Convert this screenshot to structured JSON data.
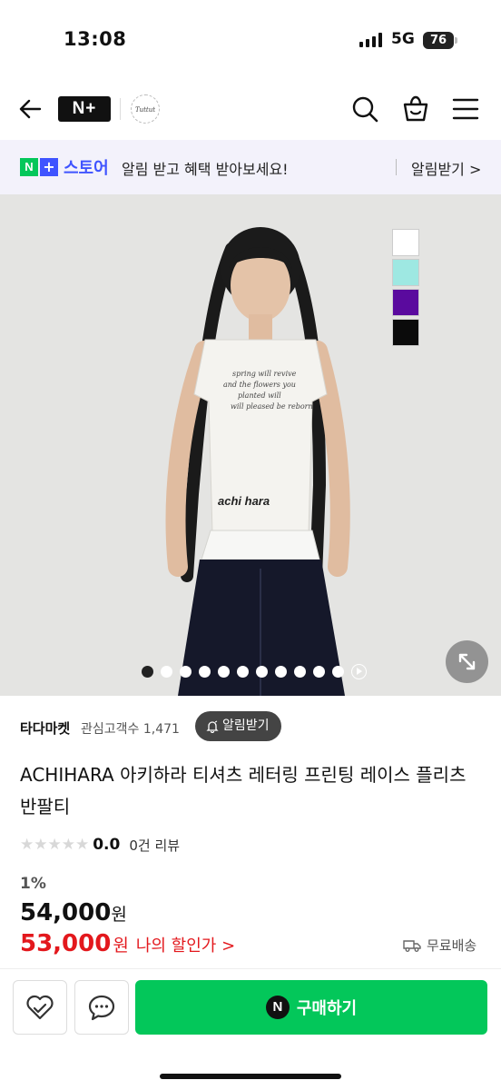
{
  "status_bar": {
    "time": "13:08",
    "network": "5G",
    "battery": "76"
  },
  "header": {
    "logo_text": "N+",
    "shop_logo_text": "Tuttut"
  },
  "banner": {
    "logo_n": "N",
    "logo_plus": "+",
    "logo_store": "스토어",
    "message": "알림 받고 혜택 받아보세요!",
    "action": "알림받기 >"
  },
  "gallery": {
    "swatch_colors": [
      "#ffffff",
      "#9ee8e2",
      "#5a0a9e",
      "#0b0b0b"
    ],
    "dot_count": 11,
    "active_dot": 0,
    "shirt_print": "achi hara"
  },
  "seller": {
    "name": "타다마켓",
    "fans": "관심고객수 1,471",
    "follow_label": "알림받기"
  },
  "product": {
    "title": "ACHIHARA 아키하라 티셔츠 레터링 프린팅 레이스 플리츠 반팔티",
    "stars": "★★★★★",
    "rating": "0.0",
    "review_count": "0건 리뷰",
    "discount_rate": "1%",
    "original_price": "54,000",
    "original_currency": "원",
    "sale_price": "53,000",
    "sale_currency": "원",
    "sale_link": "나의 할인가 >",
    "shipping": "무료배송"
  },
  "bottom_bar": {
    "buy_label": "구매하기",
    "npay_text": "N"
  },
  "colors": {
    "naver_green": "#03c75a",
    "store_blue": "#3f54ff",
    "sale_red": "#e3181d"
  }
}
